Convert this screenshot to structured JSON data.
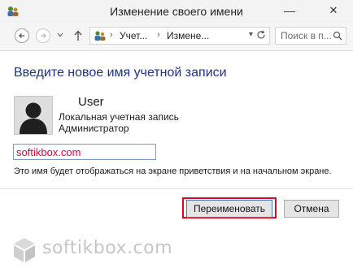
{
  "window": {
    "title": "Изменение своего имени"
  },
  "navbar": {
    "breadcrumbs": [
      "Учет...",
      "Измене..."
    ],
    "separator": "›",
    "search_placeholder": "Поиск в п..."
  },
  "content": {
    "heading": "Введите новое имя учетной записи",
    "user_name": "User",
    "account_type": "Локальная учетная запись",
    "account_role": "Администратор",
    "new_name_value": "softikbox.com",
    "hint": "Это имя будет отображаться на экране приветствия и на начальном экране."
  },
  "buttons": {
    "rename": "Переименовать",
    "cancel": "Отмена"
  },
  "watermark": {
    "text": "softikbox.com"
  },
  "colors": {
    "heading": "#1e3287",
    "highlight": "#e5001c",
    "input_text": "#e4003a"
  }
}
